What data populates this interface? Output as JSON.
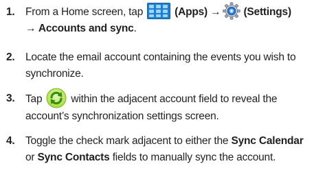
{
  "steps": [
    {
      "number": "1.",
      "line1_prefix": "From a Home screen, tap",
      "apps_label": "(Apps)",
      "arrow1": "→",
      "settings_label": "(Settings)",
      "line2": "→ Accounts and sync",
      "line2_end": "."
    },
    {
      "number": "2.",
      "line1": "Locate the email account containing the events you wish to",
      "line2": "synchronize."
    },
    {
      "number": "3.",
      "line1_prefix": "Tap",
      "line1_suffix": "within the adjacent account field to reveal the",
      "line2": "account’s synchronization settings screen."
    },
    {
      "number": "4.",
      "line1_prefix": "Toggle the check mark adjacent to either the",
      "line1_bold": "Sync Calendar",
      "line2_prefix": "or",
      "line2_bold": "Sync Contacts",
      "line2_suffix": "fields to manually sync the account."
    }
  ],
  "icons": {
    "apps": "apps-grid-icon",
    "settings": "settings-gear-icon",
    "sync": "sync-icon"
  },
  "colors": {
    "apps_blue": "#1f7fd0",
    "sync_green": "#7cc31c",
    "text": "#222222"
  }
}
